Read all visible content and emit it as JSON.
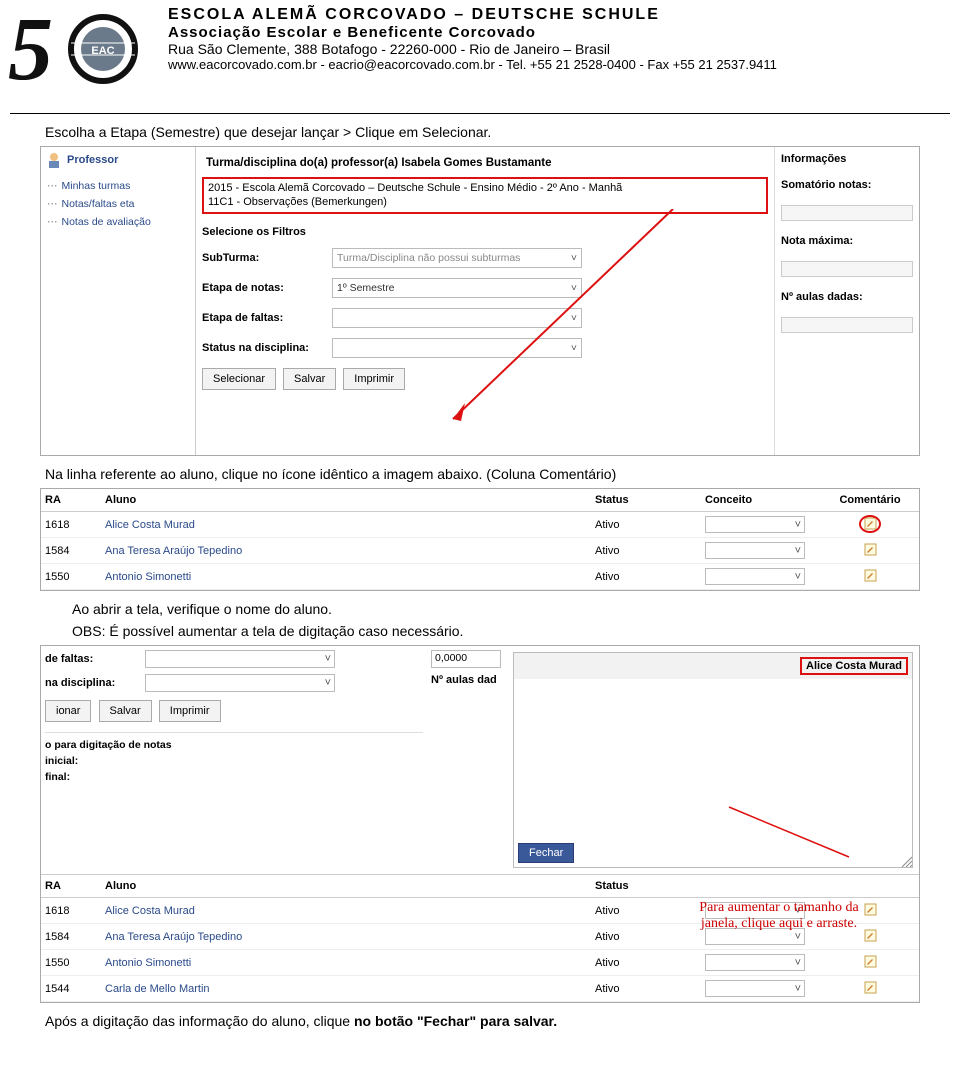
{
  "header": {
    "school": "ESCOLA ALEMÃ CORCOVADO – DEUTSCHE SCHULE",
    "assoc": "Associação Escolar e Beneficente Corcovado",
    "address": "Rua São Clemente, 388  Botafogo  -  22260-000  -  Rio de Janeiro – Brasil",
    "contact": "www.eacorcovado.com.br - eacrio@eacorcovado.com.br -  Tel. +55 21 2528-0400 - Fax +55 21 2537.9411"
  },
  "instr1": "Escolha a Etapa (Semestre) que desejar lançar > Clique em Selecionar.",
  "ss1": {
    "professor": "Professor",
    "tree": [
      "Minhas turmas",
      "Notas/faltas eta",
      "Notas de avaliação"
    ],
    "panelTitle": "Turma/disciplina do(a) professor(a) Isabela Gomes Bustamante",
    "redboxLine1": "2015 - Escola Alemã Corcovado – Deutsche Schule - Ensino Médio - 2º Ano - Manhã",
    "redboxLine2": "11C1 - Observações (Bemerkungen)",
    "filters": "Selecione os Filtros",
    "subturma_lbl": "SubTurma:",
    "subturma_val": "Turma/Disciplina não possui subturmas",
    "etapanotas_lbl": "Etapa de notas:",
    "etapanotas_val": "1º Semestre",
    "etapafaltas_lbl": "Etapa de faltas:",
    "status_lbl": "Status na disciplina:",
    "btn_sel": "Selecionar",
    "btn_salvar": "Salvar",
    "btn_imprimir": "Imprimir",
    "info": "Informações",
    "somatorio": "Somatório notas:",
    "notamax": "Nota máxima:",
    "aulas": "Nº aulas dadas:"
  },
  "instr2": "Na linha referente ao aluno, clique no ícone idêntico a imagem abaixo. (Coluna Comentário)",
  "table1": {
    "h_ra": "RA",
    "h_aluno": "Aluno",
    "h_status": "Status",
    "h_conceito": "Conceito",
    "h_coment": "Comentário",
    "rows": [
      {
        "ra": "1618",
        "nome": "Alice Costa Murad",
        "status": "Ativo"
      },
      {
        "ra": "1584",
        "nome": "Ana Teresa Araújo Tepedino",
        "status": "Ativo"
      },
      {
        "ra": "1550",
        "nome": "Antonio Simonetti",
        "status": "Ativo"
      }
    ]
  },
  "instr3a": "Ao abrir a tela, verifique o nome do aluno.",
  "instr3b": "OBS: É possível aumentar a tela de digitação caso necessário.",
  "ss3": {
    "faltas_lbl": "de faltas:",
    "disc_lbl": "na disciplina:",
    "btn_ionar": "ionar",
    "btn_salvar": "Salvar",
    "btn_imprimir": "Imprimir",
    "digit_notas": "o para digitação de notas",
    "inicial": "inicial:",
    "final": "final:",
    "zero": "0,0000",
    "aulas_lbl": "Nº aulas dad",
    "modal_name": "Alice Costa Murad",
    "fechar": "Fechar"
  },
  "table2": {
    "h_ra": "RA",
    "h_aluno": "Aluno",
    "h_status": "Status",
    "rows": [
      {
        "ra": "1618",
        "nome": "Alice Costa Murad",
        "status": "Ativo"
      },
      {
        "ra": "1584",
        "nome": "Ana Teresa Araújo Tepedino",
        "status": "Ativo"
      },
      {
        "ra": "1550",
        "nome": "Antonio Simonetti",
        "status": "Ativo"
      },
      {
        "ra": "1544",
        "nome": "Carla de Mello Martin",
        "status": "Ativo"
      }
    ]
  },
  "callout": "Para aumentar o tamanho da janela, clique aqui e arraste.",
  "final": "Após a digitação das informação do aluno, clique no botão \"Fechar\" para salvar."
}
